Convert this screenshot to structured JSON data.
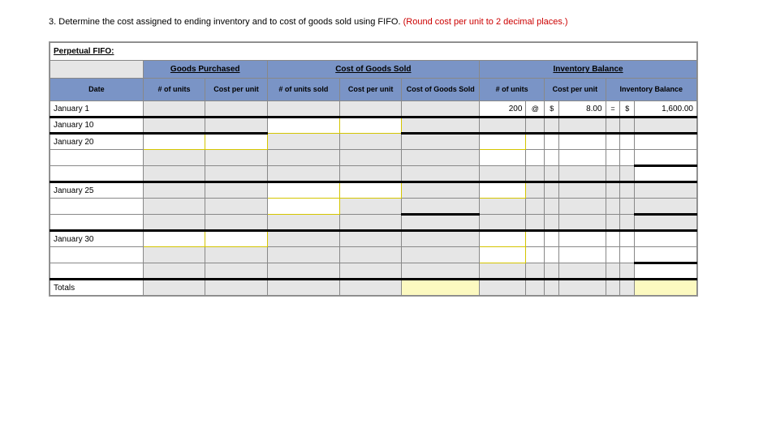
{
  "question": {
    "number": "3.",
    "text_black": "Determine the cost assigned to ending inventory and to cost of goods sold using FIFO. ",
    "text_red": "(Round cost per unit to 2 decimal places.)"
  },
  "table": {
    "title": "Perpetual FIFO:",
    "group_headers": {
      "goods_purchased": "Goods Purchased",
      "cogs": "Cost of Goods Sold",
      "inventory": "Inventory Balance"
    },
    "col_headers": {
      "date": "Date",
      "gp_units": "# of units",
      "gp_cost": "Cost per unit",
      "cogs_units": "# of units sold",
      "cogs_cost": "Cost per unit",
      "cogs_total": "Cost of Goods Sold",
      "inv_units": "# of units",
      "inv_cost": "Cost per unit",
      "inv_balance": "Inventory Balance"
    },
    "rows": {
      "jan1": {
        "date": "January 1",
        "inv_units": "200",
        "at": "@",
        "dollar1": "$",
        "inv_cost": "8.00",
        "eq": "=",
        "dollar2": "$",
        "inv_balance": "1,600.00"
      },
      "jan10": {
        "date": "January 10"
      },
      "jan20": {
        "date": "January 20"
      },
      "jan25": {
        "date": "January 25"
      },
      "jan30": {
        "date": "January 30"
      },
      "totals": {
        "label": "Totals"
      }
    }
  }
}
